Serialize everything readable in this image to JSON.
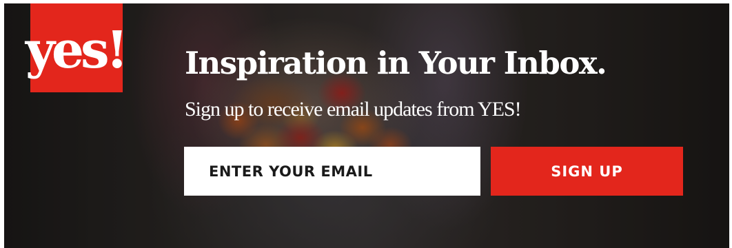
{
  "logo": {
    "text": "yes!"
  },
  "headline": "Inspiration in Your Inbox.",
  "subline": "Sign up to receive email updates from YES!",
  "form": {
    "email_placeholder": "ENTER YOUR EMAIL",
    "submit_label": "SIGN UP"
  },
  "colors": {
    "brand_red": "#e3261c",
    "text": "#ffffff",
    "input_bg": "#ffffff"
  }
}
